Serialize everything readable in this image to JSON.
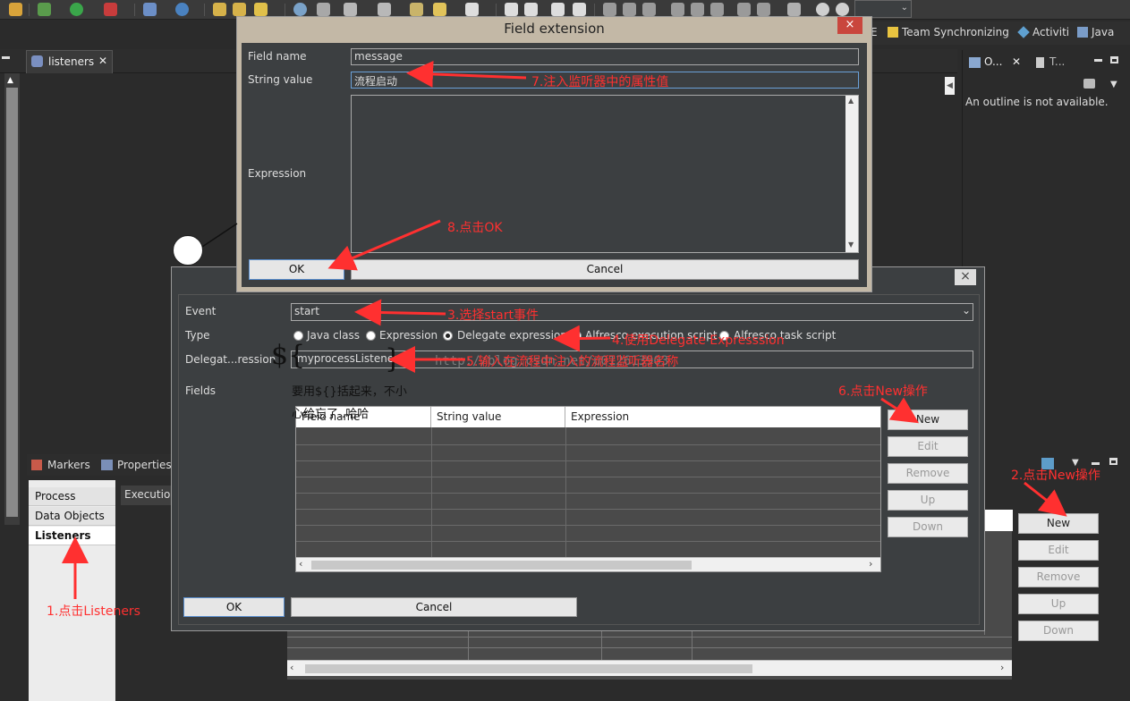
{
  "perspectives": [
    "E",
    "Team Synchronizing",
    "Activiti",
    "Java"
  ],
  "editor": {
    "tab_label": "listeners"
  },
  "outline": {
    "tab1": "O...",
    "tab2": "T...",
    "message": "An outline is not available."
  },
  "bottom": {
    "tabs": [
      "Markers",
      "Properties"
    ],
    "sidebar": [
      "Process",
      "Data Objects",
      "Listeners"
    ],
    "execution_header": "Execution",
    "buttons": {
      "new": "New",
      "edit": "Edit",
      "remove": "Remove",
      "up": "Up",
      "down": "Down"
    }
  },
  "listener_dialog": {
    "event_label": "Event",
    "event_value": "start",
    "type_label": "Type",
    "types": [
      "Java class",
      "Expression",
      "Delegate expression",
      "Alfresco execution script",
      "Alfresco task script"
    ],
    "selected_type": "Delegate expression",
    "delegate_label": "Delegat...ression",
    "delegate_value": "myprocessListener",
    "fields_label": "Fields",
    "columns": [
      "Field name",
      "String value",
      "Expression"
    ],
    "buttons": {
      "new": "New",
      "edit": "Edit",
      "remove": "Remove",
      "up": "Up",
      "down": "Down"
    },
    "ok": "OK",
    "cancel": "Cancel",
    "close": "×"
  },
  "field_dialog": {
    "title": "Field extension",
    "close": "×",
    "field_name_label": "Field name",
    "field_name_value": "message",
    "string_value_label": "String value",
    "string_value_value": "流程启动",
    "expression_label": "Expression",
    "ok": "OK",
    "cancel": "Cancel"
  },
  "annotations": {
    "a1": "1.点击Listeners",
    "a2": "2.点击New操作",
    "a3": "3.选择start事件",
    "a4": "4.使用Delegate Expresssion",
    "a5": "5.输入在流程中注入的流程监听器名称",
    "a6": "6.点击New操作",
    "a7": "7.注入监听器中的属性值",
    "a8": "8.点击OK"
  },
  "handwritten": {
    "line1": "要用${}括起来，不小",
    "line2": "心给忘了..哈哈"
  },
  "watermark": "http://blog.csdn.net/u012613903",
  "colors": {
    "annotation": "#ff3030",
    "close_button": "#c9463d",
    "dialog_frame": "#c3b8a6"
  }
}
